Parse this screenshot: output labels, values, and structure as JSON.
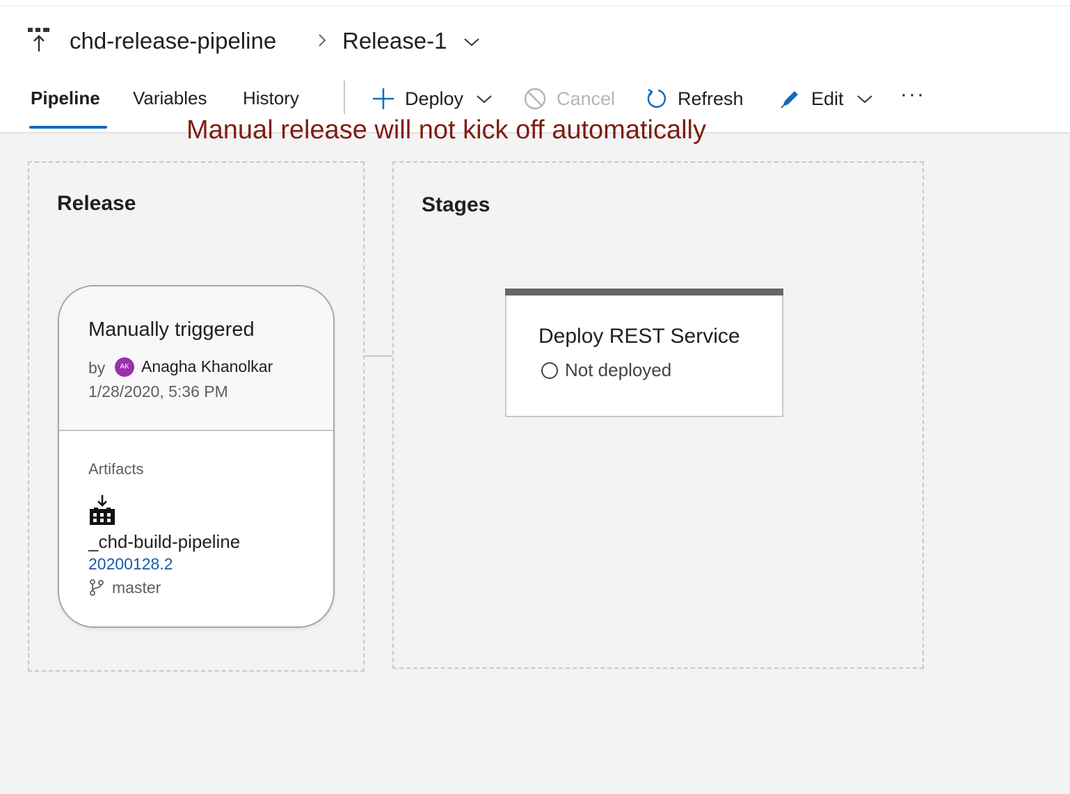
{
  "header": {
    "pipeline_name": "chd-release-pipeline",
    "release_name": "Release-1"
  },
  "tabs": [
    {
      "label": "Pipeline",
      "active": true
    },
    {
      "label": "Variables",
      "active": false
    },
    {
      "label": "History",
      "active": false
    }
  ],
  "toolbar": {
    "deploy_label": "Deploy",
    "cancel_label": "Cancel",
    "refresh_label": "Refresh",
    "edit_label": "Edit",
    "more_label": "···"
  },
  "annotation": "Manual release will not kick off automatically",
  "release_panel": {
    "title": "Release",
    "trigger": "Manually triggered",
    "by_label": "by",
    "user_initials": "AK",
    "user_name": "Anagha Khanolkar",
    "date": "1/28/2020, 5:36 PM",
    "artifacts_label": "Artifacts",
    "artifact_name": "_chd-build-pipeline",
    "artifact_version": "20200128.2",
    "branch": "master"
  },
  "stages_panel": {
    "title": "Stages",
    "stage_name": "Deploy REST Service",
    "stage_status": "Not deployed"
  },
  "colors": {
    "accent": "#0f6cbd",
    "annotation": "#7f1d10",
    "link": "#1a5aa6",
    "avatar": "#9b2fae"
  }
}
